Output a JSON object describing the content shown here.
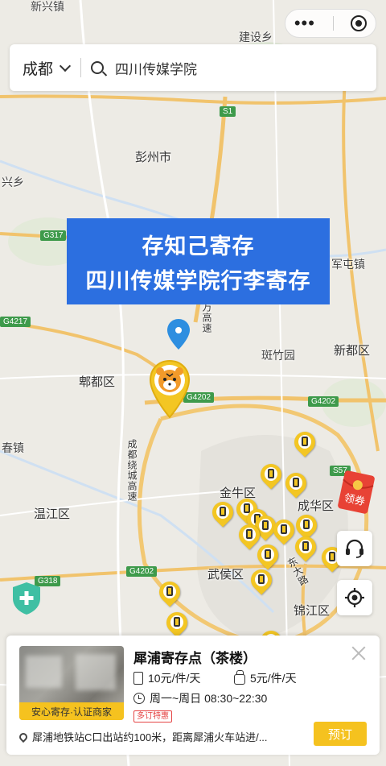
{
  "top_capsule": {
    "more_icon": "dots-icon",
    "close_icon": "target-icon"
  },
  "search": {
    "city": "成都",
    "query": "四川传媒学院",
    "search_icon": "search-icon"
  },
  "banner": {
    "line1": "存知己寄存",
    "line2": "四川传媒学院行李寄存"
  },
  "map": {
    "places": [
      {
        "id": "xinxingzhen",
        "text": "新兴镇"
      },
      {
        "id": "jianshexiang",
        "text": "建设乡"
      },
      {
        "id": "pengzhou",
        "text": "彭州市"
      },
      {
        "id": "xingxiang",
        "text": "兴乡"
      },
      {
        "id": "juntunzhen",
        "text": "军屯镇"
      },
      {
        "id": "banzhuyuan",
        "text": "斑竹园"
      },
      {
        "id": "xindou",
        "text": "新都区"
      },
      {
        "id": "pidu",
        "text": "郫都区"
      },
      {
        "id": "chunzhen",
        "text": "春镇"
      },
      {
        "id": "wenjiang",
        "text": "温江区"
      },
      {
        "id": "jinniu",
        "text": "金牛区"
      },
      {
        "id": "chenghua",
        "text": "成华区"
      },
      {
        "id": "wuhou",
        "text": "武侯区"
      },
      {
        "id": "jinjiang",
        "text": "锦江区"
      }
    ],
    "roads": [
      {
        "id": "s1",
        "text": "S1"
      },
      {
        "id": "g317",
        "text": "G317"
      },
      {
        "id": "g4217",
        "text": "G4217"
      },
      {
        "id": "g4202a",
        "text": "G4202"
      },
      {
        "id": "g4202b",
        "text": "G4202"
      },
      {
        "id": "g4202c",
        "text": "G4202"
      },
      {
        "id": "s57",
        "text": "S57"
      },
      {
        "id": "g318",
        "text": "G318"
      }
    ],
    "road_names": {
      "ring": "成都绕城高速",
      "expressway": "万高速",
      "east": "东大路"
    },
    "pin_icon": "luggage-pin-icon",
    "brand_pin_icon": "tiger-pin-icon"
  },
  "controls": {
    "coupon_label": "领券",
    "service_icon": "headset-icon",
    "locate_icon": "locate-icon",
    "safety_icon": "shield-icon"
  },
  "card": {
    "name": "犀浦寄存点（茶楼）",
    "image_tag": "安心寄存·认证商家",
    "price_suitcase": "10元/件/天",
    "price_bag": "5元/件/天",
    "hours": "周一~周日 08:30~22:30",
    "discount": "多订特惠",
    "address": "犀浦地铁站C口出站约100米，距离犀浦火车站进/...",
    "book_label": "预订",
    "close_icon": "close-icon"
  }
}
